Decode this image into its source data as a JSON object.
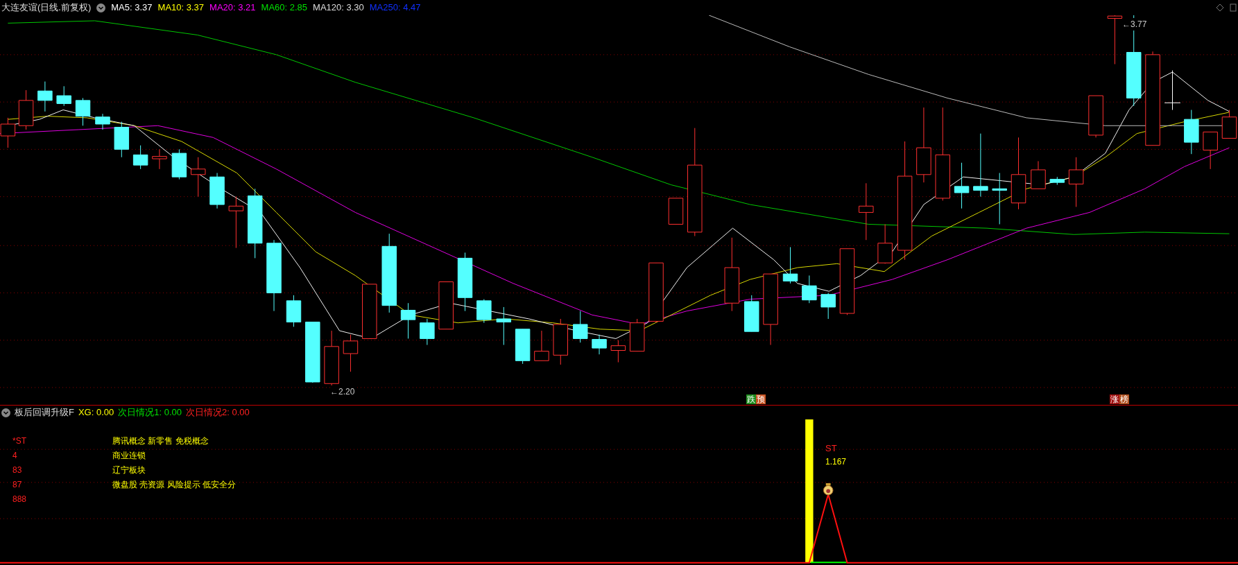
{
  "stock_chart": {
    "title": "大连友谊(日线.前复权)",
    "indicators": [
      {
        "label": "MA5: 3.37",
        "color": "#ffffff"
      },
      {
        "label": "MA10: 3.37",
        "color": "#ffff00"
      },
      {
        "label": "MA20: 3.21",
        "color": "#ff00ff"
      },
      {
        "label": "MA60: 2.85",
        "color": "#00e000"
      },
      {
        "label": "MA120: 3.30",
        "color": "#dddddd"
      },
      {
        "label": "MA250: 4.47",
        "color": "#1030ff"
      }
    ],
    "price_labels": [
      {
        "kind": "low",
        "text": "←2.20"
      },
      {
        "kind": "high",
        "text": "←3.77"
      }
    ],
    "signals": [
      {
        "kind": "fall",
        "parts": [
          {
            "text": "跌",
            "color": "#1e8c1e"
          },
          {
            "text": "预",
            "color": "#c8501e"
          }
        ]
      },
      {
        "kind": "rise",
        "parts": [
          {
            "text": "涨",
            "color": "#a01010"
          },
          {
            "text": "榜",
            "color": "#b0501e"
          }
        ]
      }
    ]
  },
  "indicator_panel": {
    "title": "板后回调升级F",
    "values": [
      {
        "label": "XG: 0.00",
        "color": "#ffff00"
      },
      {
        "label": "次日情况1: 0.00",
        "color": "#00e000"
      },
      {
        "label": "次日情况2: 0.00",
        "color": "#ff2020"
      }
    ],
    "rows": [
      {
        "code": "*ST",
        "concepts": "腾讯概念 新零售 免税概念"
      },
      {
        "code": "4",
        "concepts": "商业连锁"
      },
      {
        "code": "83",
        "concepts": "辽宁板块"
      },
      {
        "code": "87",
        "concepts": "微盘股 壳资源 风险提示 低安全分"
      },
      {
        "code": "888"
      }
    ],
    "annotation": {
      "label": "ST",
      "value": "1.167"
    }
  }
}
